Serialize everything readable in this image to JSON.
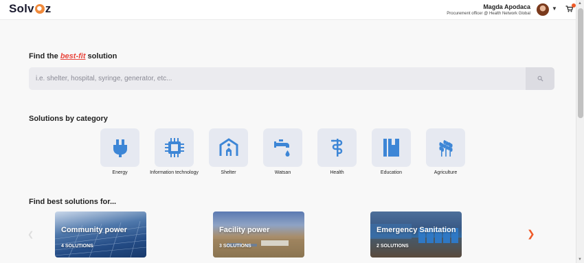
{
  "header": {
    "logo": {
      "prefix": "Solv",
      "suffix": "z"
    },
    "user": {
      "name": "Magda Apodaca",
      "role": "Procurement officer @ Health Network Global"
    },
    "icons": [
      "avatar",
      "chevron-down-icon",
      "cart-icon"
    ]
  },
  "search": {
    "title_prefix": "Find the ",
    "title_highlight": "best-fit",
    "title_suffix": " solution",
    "placeholder": "i.e. shelter, hospital, syringe, generator, etc..."
  },
  "categories": {
    "title": "Solutions by category",
    "items": [
      {
        "label": "Energy",
        "icon": "plug-icon"
      },
      {
        "label": "Information technology",
        "icon": "chip-icon"
      },
      {
        "label": "Shelter",
        "icon": "shelter-icon"
      },
      {
        "label": "Watsan",
        "icon": "tap-icon"
      },
      {
        "label": "Health",
        "icon": "caduceus-icon"
      },
      {
        "label": "Education",
        "icon": "book-icon"
      },
      {
        "label": "Agriculture",
        "icon": "wheat-icon"
      }
    ]
  },
  "best": {
    "title": "Find best solutions for...",
    "cards": [
      {
        "title": "Community power",
        "count": "4 SOLUTIONS"
      },
      {
        "title": "Facility power",
        "count": "3 SOLUTIONS"
      },
      {
        "title": "Emergency Sanitation",
        "count": "2 SOLUTIONS"
      }
    ]
  },
  "colors": {
    "accent": "#ef5a28",
    "icon": "#3d86d6",
    "tile": "#e6e9f1"
  }
}
